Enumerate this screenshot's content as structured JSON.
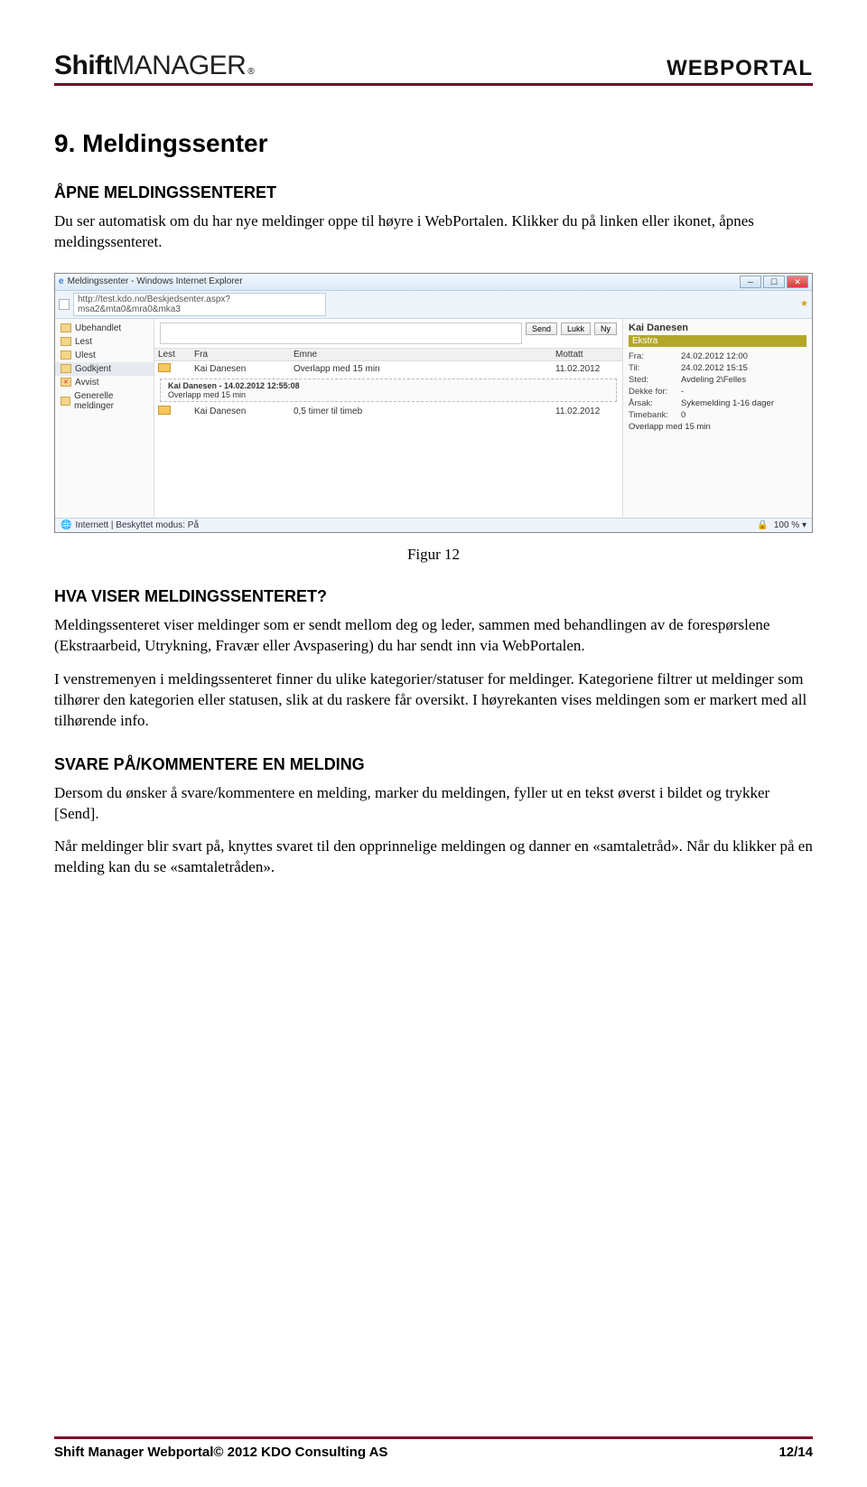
{
  "header": {
    "logo_bold": "Shift",
    "logo_thin": "MANAGER",
    "logo_reg": "®",
    "portal": "WEBPORTAL"
  },
  "doc": {
    "h1": "9. Meldingssenter",
    "h2_open": "ÅPNE MELDINGSSENTERET",
    "p_open": "Du ser automatisk om du har nye meldinger oppe til høyre i WebPortalen. Klikker du på linken eller ikonet, åpnes meldingssenteret.",
    "fig_caption": "Figur 12",
    "h2_what": "HVA VISER MELDINGSSENTERET?",
    "p_what": "Meldingssenteret viser meldinger som er sendt mellom deg og leder, sammen med behandlingen av de forespørslene (Ekstraarbeid, Utrykning, Fravær eller Avspasering) du har sendt inn via WebPortalen.",
    "p_left": "I venstremenyen i meldingssenteret finner du ulike kategorier/statuser for meldinger. Kategoriene filtrer ut meldinger som tilhører den kategorien eller statusen, slik at du raskere får oversikt. I høyrekanten vises meldingen som er markert med all tilhørende info.",
    "h2_reply": "SVARE PÅ/KOMMENTERE EN MELDING",
    "p_reply1": "Dersom du ønsker å svare/kommentere en melding, marker du meldingen, fyller ut en tekst øverst i bildet og trykker [Send].",
    "p_reply2": "Når meldinger blir svart på, knyttes svaret til den opprinnelige meldingen og danner en «samtaletråd». Når du klikker på en melding kan du se «samtaletråden»."
  },
  "screenshot": {
    "window_title": "Meldingssenter - Windows Internet Explorer",
    "url": "http://test.kdo.no/Beskjedsenter.aspx?msa2&mta0&mra0&mka3",
    "folders": [
      {
        "label": "Ubehandlet"
      },
      {
        "label": "Lest"
      },
      {
        "label": "Ulest"
      },
      {
        "label": "Godkjent"
      },
      {
        "label": "Avvist"
      },
      {
        "label": "Generelle meldinger"
      }
    ],
    "buttons": {
      "send": "Send",
      "lukk": "Lukk",
      "ny": "Ny"
    },
    "columns": {
      "lest": "Lest",
      "fra": "Fra",
      "emne": "Emne",
      "mottatt": "Mottatt"
    },
    "rows": [
      {
        "fra": "Kai Danesen",
        "emne": "Overlapp med 15 min",
        "mottatt": "11.02.2012"
      },
      {
        "fra": "Kai Danesen",
        "emne": "0,5 timer til timeb",
        "mottatt": "11.02.2012"
      }
    ],
    "expand": {
      "line1": "Kai Danesen - 14.02.2012 12:55:08",
      "line2": "Overlapp med 15 min"
    },
    "detail": {
      "name": "Kai Danesen",
      "tag": "Ekstra",
      "fields": [
        {
          "k": "Fra:",
          "v": "24.02.2012 12:00"
        },
        {
          "k": "Til:",
          "v": "24.02.2012 15:15"
        },
        {
          "k": "Sted:",
          "v": "Avdeling 2\\Felles"
        },
        {
          "k": "Dekke for:",
          "v": "-"
        },
        {
          "k": "Årsak:",
          "v": "Sykemelding 1-16 dager"
        },
        {
          "k": "Timebank:",
          "v": "0"
        }
      ],
      "note": "Overlapp med 15 min"
    },
    "statusbar": {
      "left": "Internett | Beskyttet modus: På",
      "zoom": "100 %"
    }
  },
  "footer": {
    "left": "Shift Manager Webportal© 2012 KDO Consulting AS",
    "right": "12/14"
  }
}
